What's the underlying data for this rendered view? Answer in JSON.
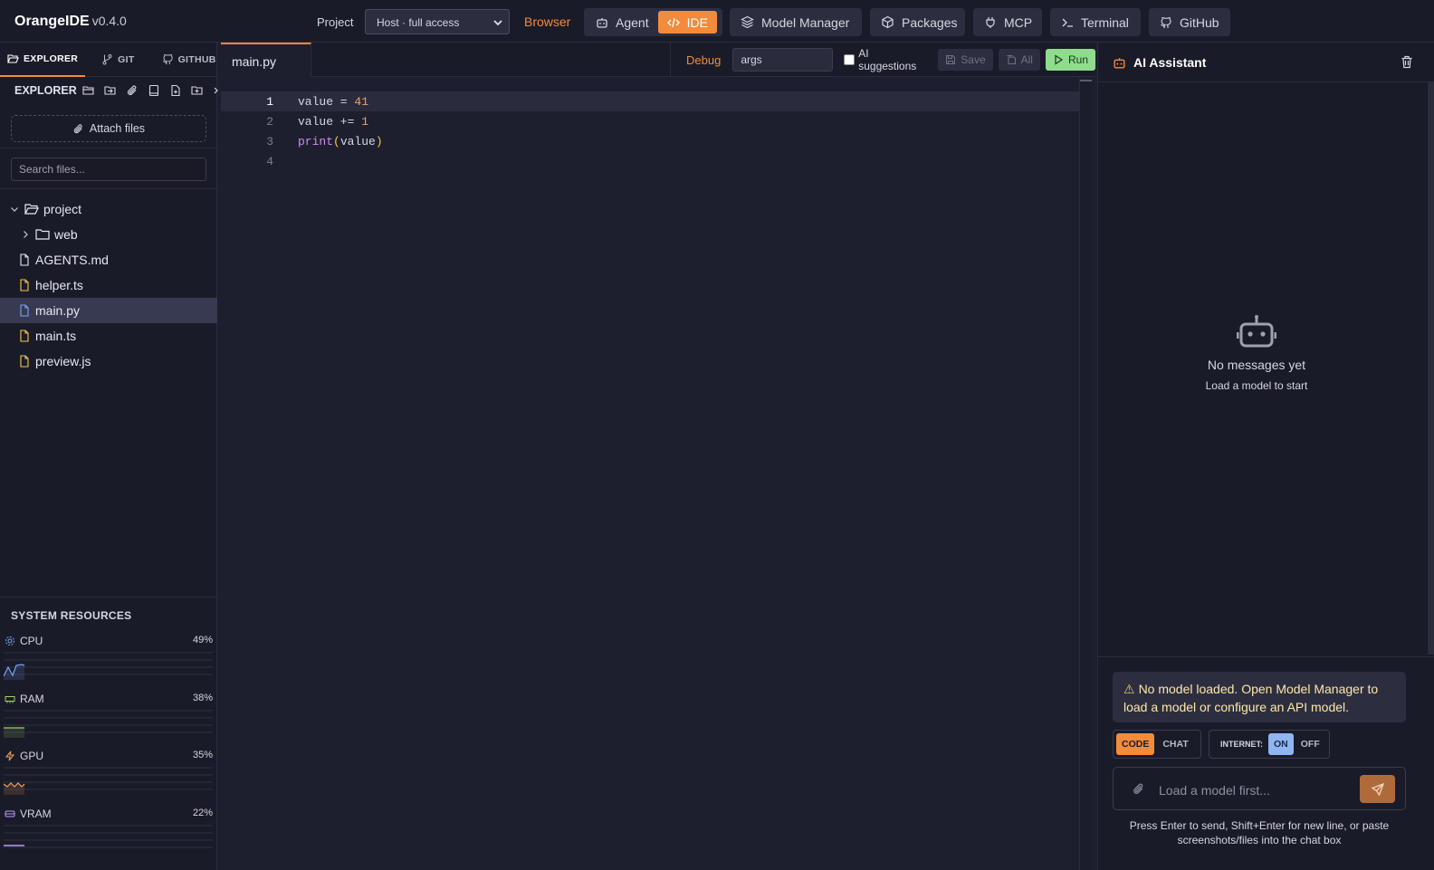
{
  "app": {
    "name": "OrangeIDE",
    "version": "v0.4.0"
  },
  "topbar": {
    "project_label": "Project",
    "project_value": "Host · full access",
    "browser_label": "Browser",
    "agent_label": "Agent",
    "ide_label": "IDE",
    "model_manager_label": "Model Manager",
    "packages_label": "Packages",
    "mcp_label": "MCP",
    "terminal_label": "Terminal",
    "github_label": "GitHub"
  },
  "left": {
    "tabs": [
      {
        "label": "EXPLORER",
        "icon": "folder-open-icon",
        "active": true
      },
      {
        "label": "GIT",
        "icon": "git-branch-icon",
        "active": false
      },
      {
        "label": "GITHUB",
        "icon": "github-icon",
        "active": false
      }
    ],
    "explorer_title": "EXPLORER",
    "attach_label": "Attach files",
    "search_placeholder": "Search files...",
    "tree": [
      {
        "name": "project",
        "type": "folder",
        "expanded": true,
        "depth": 0
      },
      {
        "name": "web",
        "type": "folder",
        "expanded": false,
        "depth": 1
      },
      {
        "name": "AGENTS.md",
        "type": "file",
        "depth": 1
      },
      {
        "name": "helper.ts",
        "type": "file",
        "depth": 1
      },
      {
        "name": "main.py",
        "type": "file",
        "depth": 1,
        "selected": true
      },
      {
        "name": "main.ts",
        "type": "file",
        "depth": 1
      },
      {
        "name": "preview.js",
        "type": "file",
        "depth": 1
      }
    ],
    "system_resources": {
      "title": "SYSTEM RESOURCES",
      "items": [
        {
          "label": "CPU",
          "percent": "49%",
          "color": "#7aa2f7",
          "icon": "cpu-icon"
        },
        {
          "label": "RAM",
          "percent": "38%",
          "color": "#9ece6a",
          "icon": "memory-icon"
        },
        {
          "label": "GPU",
          "percent": "35%",
          "color": "#f3a05c",
          "icon": "bolt-icon"
        },
        {
          "label": "VRAM",
          "percent": "22%",
          "color": "#bb9af7",
          "icon": "drive-icon"
        }
      ]
    }
  },
  "editor": {
    "tab_label": "main.py",
    "debug_label": "Debug",
    "args_value": "args",
    "ai_suggestions_label": "AI suggestions",
    "save_label": "Save",
    "all_label": "All",
    "run_label": "Run",
    "lines": [
      {
        "n": "1",
        "tokens": [
          {
            "t": "value = ",
            "c": ""
          },
          {
            "t": "41",
            "c": "num"
          }
        ]
      },
      {
        "n": "2",
        "tokens": [
          {
            "t": "value += ",
            "c": ""
          },
          {
            "t": "1",
            "c": "num"
          }
        ]
      },
      {
        "n": "3",
        "tokens": [
          {
            "t": "print",
            "c": "kw"
          },
          {
            "t": "(",
            "c": "par"
          },
          {
            "t": "value",
            "c": ""
          },
          {
            "t": ")",
            "c": "par"
          }
        ]
      },
      {
        "n": "4",
        "tokens": []
      }
    ],
    "current_line": "1"
  },
  "assistant": {
    "title": "AI Assistant",
    "empty_title": "No messages yet",
    "empty_subtitle": "Load a model to start",
    "warning": "No model loaded. Open Model Manager to load a model or configure an API model.",
    "mode_code": "CODE",
    "mode_chat": "CHAT",
    "internet_label": "INTERNET:",
    "internet_on": "ON",
    "internet_off": "OFF",
    "input_placeholder": "Load a model first...",
    "hint": "Press Enter to send, Shift+Enter for new line, or paste screenshots/files into the chat box"
  }
}
